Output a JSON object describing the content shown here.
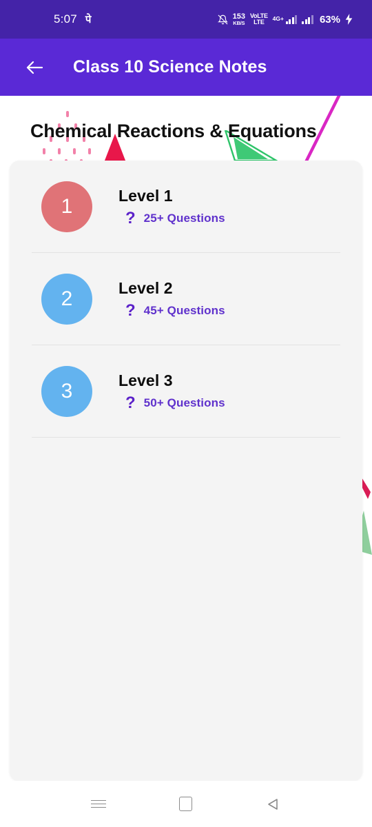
{
  "status_bar": {
    "time": "5:07",
    "ampm": "पे",
    "notification_icon": "bell-off-icon",
    "network_speed_value": "153",
    "network_speed_unit": "KB/S",
    "volte_line1": "VoLTE",
    "volte_line2": "LTE",
    "network_type": "4G+",
    "battery_percent": "63%",
    "charging_icon": "charging-bolt-icon",
    "background_color": "#4423a8"
  },
  "app_bar": {
    "back_icon": "arrow-left-icon",
    "title": "Class 10 Science Notes",
    "background_color": "#5a29d6"
  },
  "page": {
    "heading": "Chemical Reactions & Equations",
    "card_background": "#f4f4f4"
  },
  "decorations": {
    "dot_color": "#f06b9a",
    "red_triangle_color": "#e8174a",
    "green_triangle_color": "#2fc46a",
    "magenta_line_color": "#d927c4"
  },
  "levels": [
    {
      "number": "1",
      "title": "Level 1",
      "question_icon": "question-mark-icon",
      "questions": "25+ Questions",
      "circle_color": "#e07377"
    },
    {
      "number": "2",
      "title": "Level 2",
      "question_icon": "question-mark-icon",
      "questions": "45+ Questions",
      "circle_color": "#63b3ef"
    },
    {
      "number": "3",
      "title": "Level 3",
      "question_icon": "question-mark-icon",
      "questions": "50+ Questions",
      "circle_color": "#63b3ef"
    }
  ],
  "nav_bar": {
    "recents_label": "recents-icon",
    "home_label": "home-icon",
    "back_label": "back-icon"
  }
}
